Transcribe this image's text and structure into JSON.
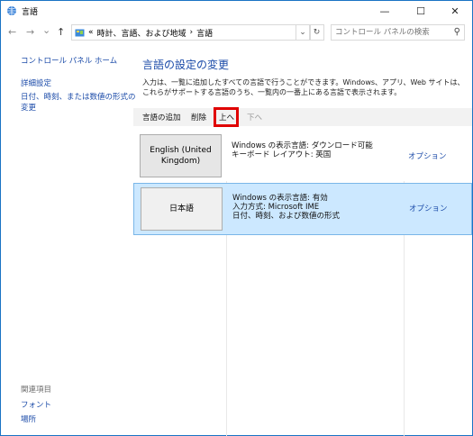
{
  "window": {
    "title": "言語",
    "minimize": "—",
    "maximize": "☐",
    "close": "✕"
  },
  "address": {
    "back": "←",
    "forward": "→",
    "recent": "⌄",
    "up": "↑",
    "path_prefix": "«",
    "crumb1": "時計、言語、および地域",
    "separator": "›",
    "crumb2": "言語",
    "dropdown": "⌄",
    "refresh": "↻",
    "search_placeholder": "コントロール パネルの検索"
  },
  "sidebar": {
    "home": "コントロール パネル ホーム",
    "advanced": "詳細設定",
    "datetime_line1": "日付、時刻、または数値の形式の",
    "datetime_line2": "変更",
    "related_label": "関連項目",
    "fonts": "フォント",
    "location": "場所"
  },
  "main": {
    "heading": "言語の設定の変更",
    "description": "入力は、一覧に追加したすべての言語で行うことができます。Windows、アプリ、Web サイトは、これらがサポートする言語のうち、一覧内の一番上にある言語で表示されます。"
  },
  "toolbar": {
    "add": "言語の追加",
    "remove": "削除",
    "up": "上へ",
    "down": "下へ"
  },
  "languages": [
    {
      "name_line1": "English (United",
      "name_line2": "Kingdom)",
      "line1": "Windows の表示言語: ダウンロード可能",
      "line2": "キーボード レイアウト: 英国",
      "line3": "",
      "options": "オプション",
      "selected": false
    },
    {
      "name_line1": "日本語",
      "name_line2": "",
      "line1": "Windows の表示言語: 有効",
      "line2": "入力方式: Microsoft IME",
      "line3": "日付、時刻、および数値の形式",
      "options": "オプション",
      "selected": true
    }
  ],
  "colors": {
    "link": "#1a4aa8",
    "selection": "#cce8ff",
    "highlight_box": "#e00000"
  }
}
